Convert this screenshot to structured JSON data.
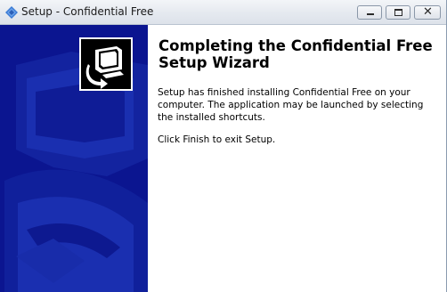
{
  "window": {
    "title": "Setup - Confidential Free",
    "icon": "setup-diamond-icon",
    "controls": {
      "minimize": "minimize-icon",
      "maximize": "maximize-icon",
      "close": "close-icon"
    },
    "close_glyph": "✕"
  },
  "wizard": {
    "heading": "Completing the Confidential Free Setup Wizard",
    "paragraphs": [
      "Setup has finished installing Confidential Free on your computer. The application may be launched by selecting the installed shortcuts.",
      "Click Finish to exit Setup."
    ],
    "banner_logo": "computer-install-icon"
  },
  "colors": {
    "banner": "#0b1590",
    "banner_shape": "#1a3aa8",
    "title_icon": "#3a7bd5"
  }
}
